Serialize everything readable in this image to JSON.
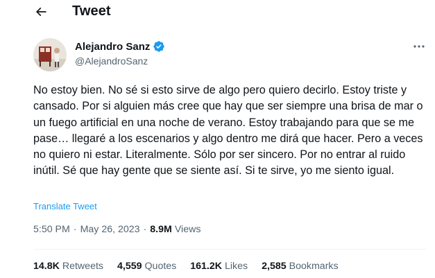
{
  "header": {
    "title": "Tweet",
    "back_icon": "arrow-left-icon"
  },
  "author": {
    "name": "Alejandro Sanz",
    "handle": "@AlejandroSanz",
    "verified_icon": "verified-badge-icon",
    "verified_color": "#1d9bf0"
  },
  "tweet": {
    "text": "No estoy bien. No sé si esto sirve de algo pero quiero decirlo. Estoy triste y cansado. Por si alguien más cree que hay que ser siempre una brisa de mar o un fuego artificial en una noche de verano. Estoy trabajando para que se me pase… llegaré a los escenarios y algo dentro me dirá que hacer. Pero a veces no quiero ni estar. Literalmente. Sólo por ser sincero. Por no entrar al ruido inútil. Sé que hay gente que se siente así. Si te sirve, yo me siento igual.",
    "translate_label": "Translate Tweet",
    "time": "5:50 PM",
    "separator": "·",
    "date": "May 26, 2023",
    "views_count": "8.9M",
    "views_label": "Views"
  },
  "stats": [
    {
      "count": "14.8K",
      "label": "Retweets"
    },
    {
      "count": "4,559",
      "label": "Quotes"
    },
    {
      "count": "161.2K",
      "label": "Likes"
    },
    {
      "count": "2,585",
      "label": "Bookmarks"
    }
  ],
  "colors": {
    "text": "#0f1419",
    "secondary": "#536471",
    "accent": "#1d9bf0"
  }
}
